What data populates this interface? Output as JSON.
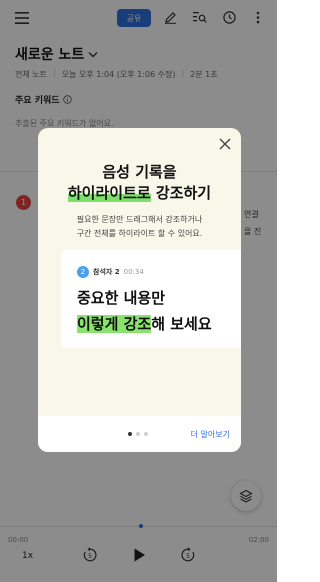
{
  "topbar": {
    "share_label": "공유"
  },
  "note": {
    "title": "새로운 노트",
    "meta_folder": "전체 노트",
    "meta_date": "오늘 오후 1:04 (오후 1:06 수정)",
    "meta_duration": "2분 1초"
  },
  "keywords": {
    "title": "주요 키워드",
    "empty_text": "추출된 주요 키워드가 없어요."
  },
  "transcript": {
    "speaker_number": "1",
    "side_text_1": "연결",
    "side_text_2": "을 진"
  },
  "modal": {
    "title_line1": "음성 기록을",
    "title_line2_highlight": "하이라이트로",
    "title_line2_rest": " 강조하기",
    "desc_line1": "필요한 문장만 드래그해서 강조하거나",
    "desc_line2": "구간 전체를 하이라이트 할 수 있어요.",
    "example": {
      "badge": "2",
      "speaker": "참석자 2",
      "time": "00:34",
      "line1": "중요한 내용만",
      "line2_highlight": "이렇게 강조",
      "line2_rest": "해 보세요"
    },
    "page_count": 3,
    "active_page": 1,
    "learn_more": "더 알아보기"
  },
  "player": {
    "current_time": "00:00",
    "total_time": "02:00",
    "speed": "1x",
    "skip_back_seconds": "5",
    "skip_forward_seconds": "5",
    "progress": 0.0
  },
  "colors": {
    "accent": "#2f6fe0",
    "highlight": "#8be36f",
    "speaker1": "#e8433f",
    "speaker2": "#4aa0f0",
    "modal_bg": "#f8f7ea"
  }
}
